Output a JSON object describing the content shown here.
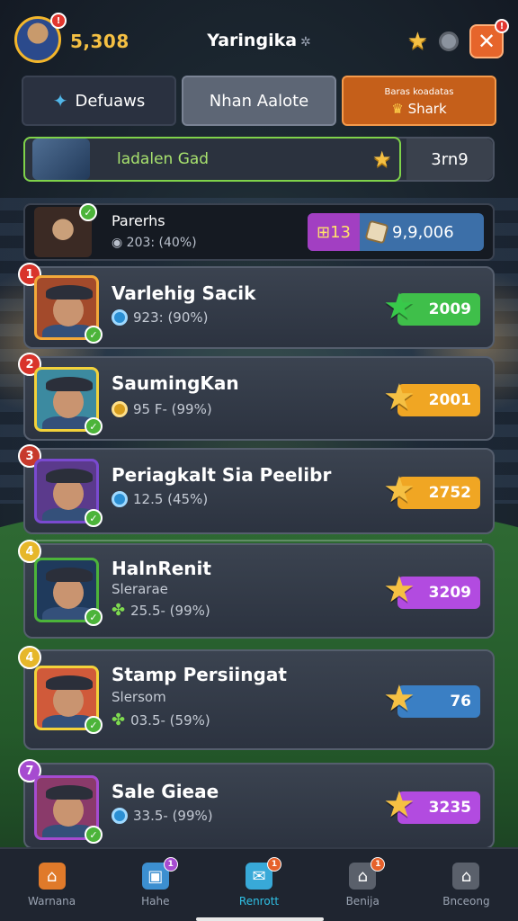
{
  "header": {
    "coins": "5,308",
    "title": "Yaringika",
    "title_symbol": "✲",
    "avatar_badge": "!",
    "close_badge": "!",
    "close_label": "✕"
  },
  "tabs": [
    {
      "label": "Defuaws",
      "icon": "shield-icon"
    },
    {
      "label": "Nhan Aalote"
    },
    {
      "label_small": "Baras koadatas",
      "label": "Shark",
      "icon": "trophy-icon"
    }
  ],
  "my_rank": {
    "label": "ladalen Gad",
    "value": "3rn9"
  },
  "header_card": {
    "name": "Parerhs",
    "stat": "203: (40%)",
    "badge_value": "13",
    "total": "9,9,006"
  },
  "players": [
    {
      "rank": "1",
      "name": "Varlehig Sacik",
      "subtitle": "",
      "stat": "923: (90%)",
      "coin": "blue",
      "score": "2009",
      "score_color": "#3fbf4a",
      "star_color": "#38c94a",
      "rank_color": "#d9342b",
      "frame_color": "#f3a93a",
      "bg": "#a34a2b"
    },
    {
      "rank": "2",
      "name": "SaumingKan",
      "subtitle": "",
      "stat": "95 F- (99%)",
      "coin": "gold",
      "score": "2001",
      "score_color": "#f0a623",
      "star_color": "#f5c043",
      "rank_color": "#d9342b",
      "frame_color": "#f3d23a",
      "bg": "#3c8aa0"
    },
    {
      "rank": "3",
      "name": "Periagkalt Sia Peelibr",
      "subtitle": "",
      "stat": "12.5 (45%)",
      "coin": "blue",
      "score": "2752",
      "score_color": "#f0a623",
      "star_color": "#f5c043",
      "rank_color": "#c73a2c",
      "frame_color": "#7a4ad0",
      "bg": "#5b3a8c"
    },
    {
      "rank": "4",
      "name": "HalnRenit",
      "subtitle": "Slerarae",
      "stat": "25.5- (99%)",
      "coin": "green",
      "score": "3209",
      "score_color": "#b24be0",
      "star_color": "#f5c043",
      "rank_color": "#e6b72a",
      "frame_color": "#4cb43a",
      "bg": "#1f3a5c"
    },
    {
      "rank": "4",
      "name": "Stamp Persiingat",
      "subtitle": "Slersom",
      "stat": "03.5- (59%)",
      "coin": "green",
      "score": "76",
      "score_color": "#3a7fc4",
      "star_color": "#f5c043",
      "rank_color": "#e6b72a",
      "frame_color": "#f3d23a",
      "bg": "#d05a3a"
    },
    {
      "rank": "7",
      "name": "Sale Gieae",
      "subtitle": "",
      "stat": "33.5- (99%)",
      "coin": "blue",
      "score": "3235",
      "score_color": "#b24be0",
      "star_color": "#f5c043",
      "rank_color": "#a64bd0",
      "frame_color": "#a64bd0",
      "bg": "#8a3a6a"
    }
  ],
  "nav": [
    {
      "label": "Warnana",
      "icon": "home-icon",
      "badge": "",
      "active": false
    },
    {
      "label": "Hahe",
      "icon": "chest-icon",
      "badge": "1",
      "active": false
    },
    {
      "label": "Renrott",
      "icon": "mail-icon",
      "badge": "1",
      "active": true
    },
    {
      "label": "Benija",
      "icon": "shop-icon",
      "badge": "1",
      "active": false
    },
    {
      "label": "Bnceong",
      "icon": "settings-icon",
      "badge": "",
      "active": false
    }
  ]
}
